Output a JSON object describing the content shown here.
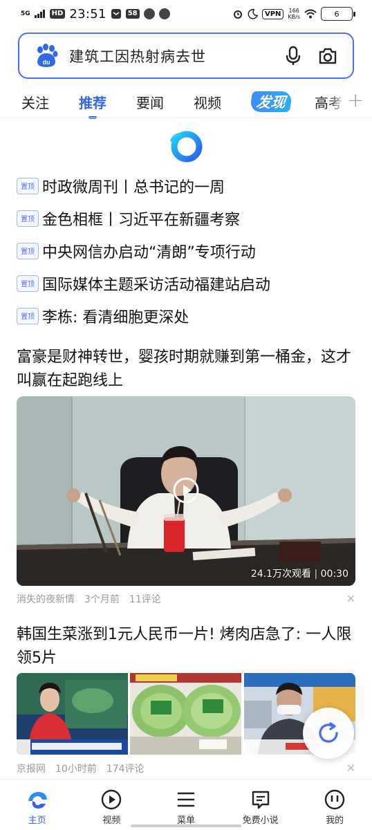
{
  "status_bar": {
    "network": "5G",
    "hd": "HD",
    "time": "23:51",
    "badge": "58",
    "vpn": "VPN",
    "speed_value": "166",
    "speed_unit": "KB/s",
    "battery": "6"
  },
  "search": {
    "query": "建筑工因热射病去世"
  },
  "tabs": [
    {
      "label": "关注"
    },
    {
      "label": "推荐",
      "active": true
    },
    {
      "label": "要闻"
    },
    {
      "label": "视频"
    },
    {
      "label": "发现"
    },
    {
      "label": "高考"
    }
  ],
  "pinned": {
    "tag": "置顶",
    "items": [
      {
        "title": "时政微周刊丨总书记的一周"
      },
      {
        "title": "金色相框丨习近平在新疆考察"
      },
      {
        "title": "中央网信办启动“清朗”专项行动"
      },
      {
        "title": "国际媒体主题采访活动福建站启动"
      },
      {
        "title": "李栋: 看清细胞更深处"
      }
    ]
  },
  "feed": [
    {
      "title": "富豪是财神转世，婴孩时期就赚到第一桶金，这才叫赢在起跑线上",
      "views": "24.1万次观看",
      "duration": "00:30",
      "source": "消失的夜新情",
      "time": "3个月前",
      "comments": "11评论"
    },
    {
      "title": "韩国生菜涨到1元人民币一片! 烤肉店急了: 一人限领5片",
      "source": "京报网",
      "time": "10小时前",
      "comments": "174评论"
    }
  ],
  "bottom_nav": [
    {
      "label": "主页",
      "active": true
    },
    {
      "label": "视频"
    },
    {
      "label": "菜单"
    },
    {
      "label": "免费小说"
    },
    {
      "label": "我的"
    }
  ],
  "colors": {
    "accent": "#3164e6",
    "search_border": "#4e6ef2",
    "meta_text": "#999999"
  }
}
